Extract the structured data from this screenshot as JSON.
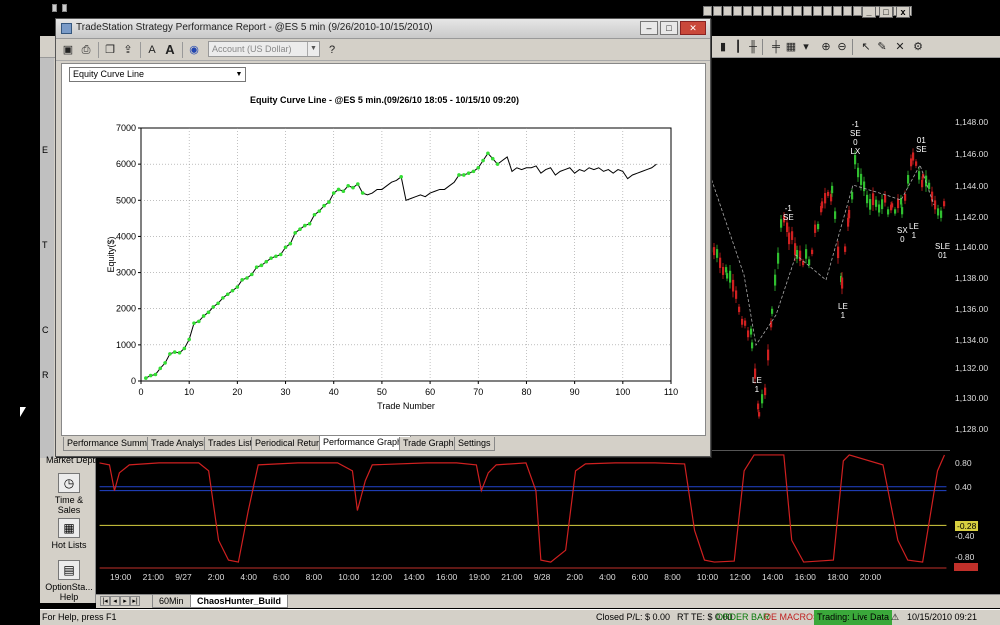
{
  "report": {
    "title": "TradeStation Strategy Performance Report - @ES 5 min (9/26/2010-10/15/2010)",
    "account_select": "Account (US Dollar)",
    "graph_select": "Equity Curve Line",
    "tabs": [
      {
        "label": "Performance Summary",
        "active": false
      },
      {
        "label": "Trade Analysis",
        "active": false
      },
      {
        "label": "Trades List",
        "active": false
      },
      {
        "label": "Periodical Returns",
        "active": false
      },
      {
        "label": "Performance Graphs",
        "active": true
      },
      {
        "label": "Trade Graphs",
        "active": false
      },
      {
        "label": "Settings",
        "active": false
      }
    ]
  },
  "chart_data": {
    "type": "line",
    "title": "Equity Curve Line - @ES 5 min.(09/26/10 18:05 - 10/15/10 09:20)",
    "xlabel": "Trade Number",
    "ylabel": "Equity($)",
    "xlim": [
      0,
      110
    ],
    "ylim": [
      0,
      7000
    ],
    "xticks": [
      0,
      10,
      20,
      30,
      40,
      50,
      60,
      70,
      80,
      90,
      100,
      110
    ],
    "yticks": [
      0,
      1000,
      2000,
      3000,
      4000,
      5000,
      6000,
      7000
    ],
    "grid": true,
    "series": [
      {
        "color": "#000000",
        "marker_color": "#33dd33",
        "x": [
          1,
          2,
          3,
          4,
          5,
          6,
          7,
          8,
          9,
          10,
          11,
          12,
          13,
          14,
          15,
          16,
          17,
          18,
          19,
          20,
          21,
          22,
          23,
          24,
          25,
          26,
          27,
          28,
          29,
          30,
          31,
          32,
          33,
          34,
          35,
          36,
          37,
          38,
          39,
          40,
          41,
          42,
          43,
          44,
          45,
          46,
          47,
          48,
          49,
          50,
          51,
          52,
          53,
          54,
          55,
          56,
          57,
          58,
          59,
          60,
          61,
          62,
          63,
          64,
          65,
          66,
          67,
          68,
          69,
          70,
          71,
          72,
          73,
          74,
          75,
          76,
          77,
          78,
          79,
          80,
          81,
          82,
          83,
          84,
          85,
          86,
          87,
          88,
          89,
          90,
          91,
          92,
          93,
          94,
          95,
          96,
          97,
          98,
          99,
          100,
          101,
          102,
          103,
          104,
          105,
          106,
          107
        ],
        "y": [
          80,
          150,
          180,
          350,
          500,
          750,
          800,
          780,
          900,
          1150,
          1600,
          1650,
          1800,
          1900,
          2050,
          2150,
          2300,
          2400,
          2500,
          2600,
          2800,
          2850,
          2950,
          3150,
          3200,
          3300,
          3400,
          3450,
          3500,
          3700,
          3800,
          4100,
          4200,
          4300,
          4350,
          4600,
          4700,
          4850,
          4950,
          5200,
          5300,
          5250,
          5400,
          5350,
          5450,
          5200,
          5150,
          5200,
          5300,
          5300,
          5400,
          5500,
          5550,
          5650,
          5000,
          5050,
          5100,
          5150,
          5100,
          5200,
          5250,
          5300,
          5300,
          5400,
          5500,
          5700,
          5700,
          5750,
          5800,
          5900,
          6100,
          6300,
          6150,
          6000,
          6100,
          6200,
          5800,
          5900,
          5850,
          5900,
          5900,
          5950,
          5750,
          5850,
          5900,
          5700,
          5800,
          5850,
          5900,
          5750,
          5850,
          5800,
          5900,
          5850,
          5900,
          5800,
          5850,
          5750,
          5850,
          5800,
          5600,
          5700,
          5750,
          5800,
          5850,
          5900,
          6000
        ],
        "marked_x": [
          1,
          2,
          3,
          4,
          5,
          6,
          7,
          8,
          9,
          10,
          11,
          12,
          13,
          14,
          15,
          16,
          17,
          18,
          19,
          20,
          21,
          22,
          23,
          24,
          25,
          26,
          27,
          28,
          29,
          30,
          31,
          32,
          33,
          34,
          35,
          36,
          37,
          38,
          39,
          40,
          41,
          42,
          43,
          44,
          45,
          46,
          54,
          66,
          67,
          68,
          69,
          70,
          71,
          72,
          73,
          74
        ]
      }
    ]
  },
  "app": {
    "price_labels": [
      "1,148.00",
      "1,146.00",
      "1,144.00",
      "1,142.00",
      "1,140.00",
      "1,138.00",
      "1,136.00",
      "1,134.00",
      "1,132.00",
      "1,130.00",
      "1,128.00"
    ],
    "osc_labels": [
      "0.80",
      "0.40",
      "-0.28",
      "-0.40",
      "-0.80"
    ],
    "time_labels": [
      "19:00",
      "21:00",
      "9/27",
      "2:00",
      "4:00",
      "6:00",
      "8:00",
      "10:00",
      "12:00",
      "14:00",
      "16:00",
      "19:00",
      "21:00",
      "9/28",
      "2:00",
      "4:00",
      "6:00",
      "8:00",
      "10:00",
      "12:00",
      "14:00",
      "16:00",
      "18:00",
      "20:00"
    ],
    "annotations": {
      "le1": "LE",
      "le1n": "1",
      "se1": "SE",
      "se1n": "-1",
      "le2": "LE",
      "le2n": "1",
      "lx": "LX",
      "se2": "SE",
      "se2n": "-1",
      "se2z": "0",
      "se3": "SE",
      "se3n": "01",
      "sx": "SX",
      "sxn": "0",
      "le3": "LE",
      "le3n": "1",
      "sle": "SLE",
      "slen": "01"
    },
    "rail": {
      "market_depth": "Market Depth",
      "time_sales": "Time & Sales",
      "hot_lists": "Hot Lists",
      "option_station": "OptionSta... Help",
      "letters": [
        "E",
        "T",
        "C",
        "R"
      ]
    },
    "sheet_tabs": [
      {
        "label": "60Min",
        "active": false
      },
      {
        "label": "ChaosHunter_Build",
        "active": true
      }
    ],
    "status": {
      "help": "For Help, press F1",
      "closed_pl": "Closed P/L: $ 0.00",
      "rt_te": "RT TE: $ 0.00",
      "order_bar": "ORDER BAR",
      "oe_macros": "OE MACROS",
      "trading": "Trading: Live",
      "data": "Data",
      "datetime": "10/15/2010 09:21"
    }
  }
}
